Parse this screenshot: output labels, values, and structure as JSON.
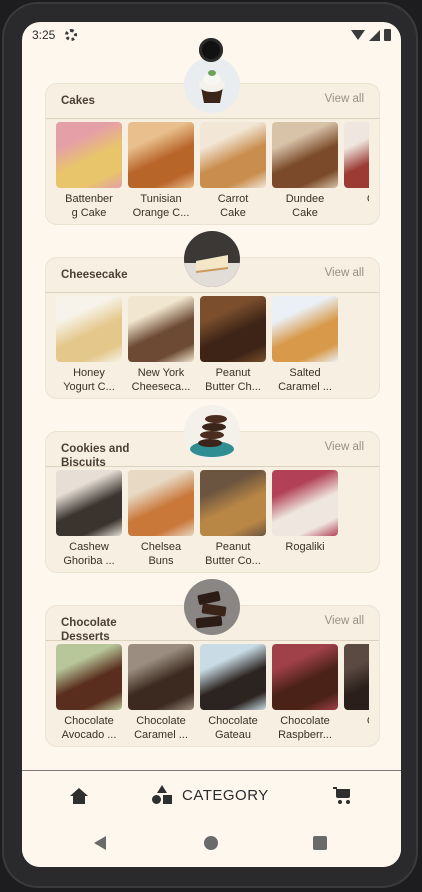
{
  "status_bar": {
    "time": "3:25"
  },
  "sections": [
    {
      "title": "Cakes",
      "view_all": "View all",
      "items": [
        {
          "label": "Battenber\ng Cake",
          "colors": [
            "#e8c56a",
            "#e59fa7"
          ]
        },
        {
          "label": "Tunisian\nOrange C...",
          "colors": [
            "#b8652a",
            "#e9c08d"
          ]
        },
        {
          "label": "Carrot\nCake",
          "colors": [
            "#c98d4d",
            "#f2e7d7"
          ]
        },
        {
          "label": "Dundee\nCake",
          "colors": [
            "#7b4a2a",
            "#d8c3a9"
          ]
        },
        {
          "label": "Chri\nC",
          "colors": [
            "#9b3b34",
            "#efe7df"
          ]
        }
      ]
    },
    {
      "title": "Cheesecake",
      "view_all": "View all",
      "items": [
        {
          "label": "Honey\nYogurt C...",
          "colors": [
            "#e4c78a",
            "#f7f3ea"
          ]
        },
        {
          "label": "New York\nCheeseca...",
          "colors": [
            "#6d4a34",
            "#f1e6cf"
          ]
        },
        {
          "label": "Peanut\nButter Ch...",
          "colors": [
            "#3e2416",
            "#7b4f2e"
          ]
        },
        {
          "label": "Salted\nCaramel ...",
          "colors": [
            "#d89a4a",
            "#eaf0f5"
          ]
        }
      ]
    },
    {
      "title": "Cookies and\nBiscuits",
      "view_all": "View all",
      "items": [
        {
          "label": "Cashew\nGhoriba ...",
          "colors": [
            "#3a332e",
            "#e7dfd5"
          ]
        },
        {
          "label": "Chelsea\nBuns",
          "colors": [
            "#c9783a",
            "#e7d9c4"
          ]
        },
        {
          "label": "Peanut\nButter Co...",
          "colors": [
            "#b98745",
            "#6b5440"
          ]
        },
        {
          "label": "Rogaliki",
          "colors": [
            "#efe7df",
            "#b24157"
          ]
        }
      ]
    },
    {
      "title": "Chocolate\nDesserts",
      "view_all": "View all",
      "items": [
        {
          "label": "Chocolate\nAvocado ...",
          "colors": [
            "#5a2e1e",
            "#b8c79a"
          ]
        },
        {
          "label": "Chocolate\nCaramel ...",
          "colors": [
            "#3c2a20",
            "#9b8e80"
          ]
        },
        {
          "label": "Chocolate\nGateau",
          "colors": [
            "#2c2420",
            "#c9dce6"
          ]
        },
        {
          "label": "Chocolate\nRaspberr...",
          "colors": [
            "#4a2218",
            "#a04048"
          ]
        },
        {
          "label": "Cho\nSc",
          "colors": [
            "#2a1f1a",
            "#5b4a42"
          ]
        }
      ]
    }
  ],
  "bottom_nav": {
    "category_label": "CATEGORY"
  }
}
